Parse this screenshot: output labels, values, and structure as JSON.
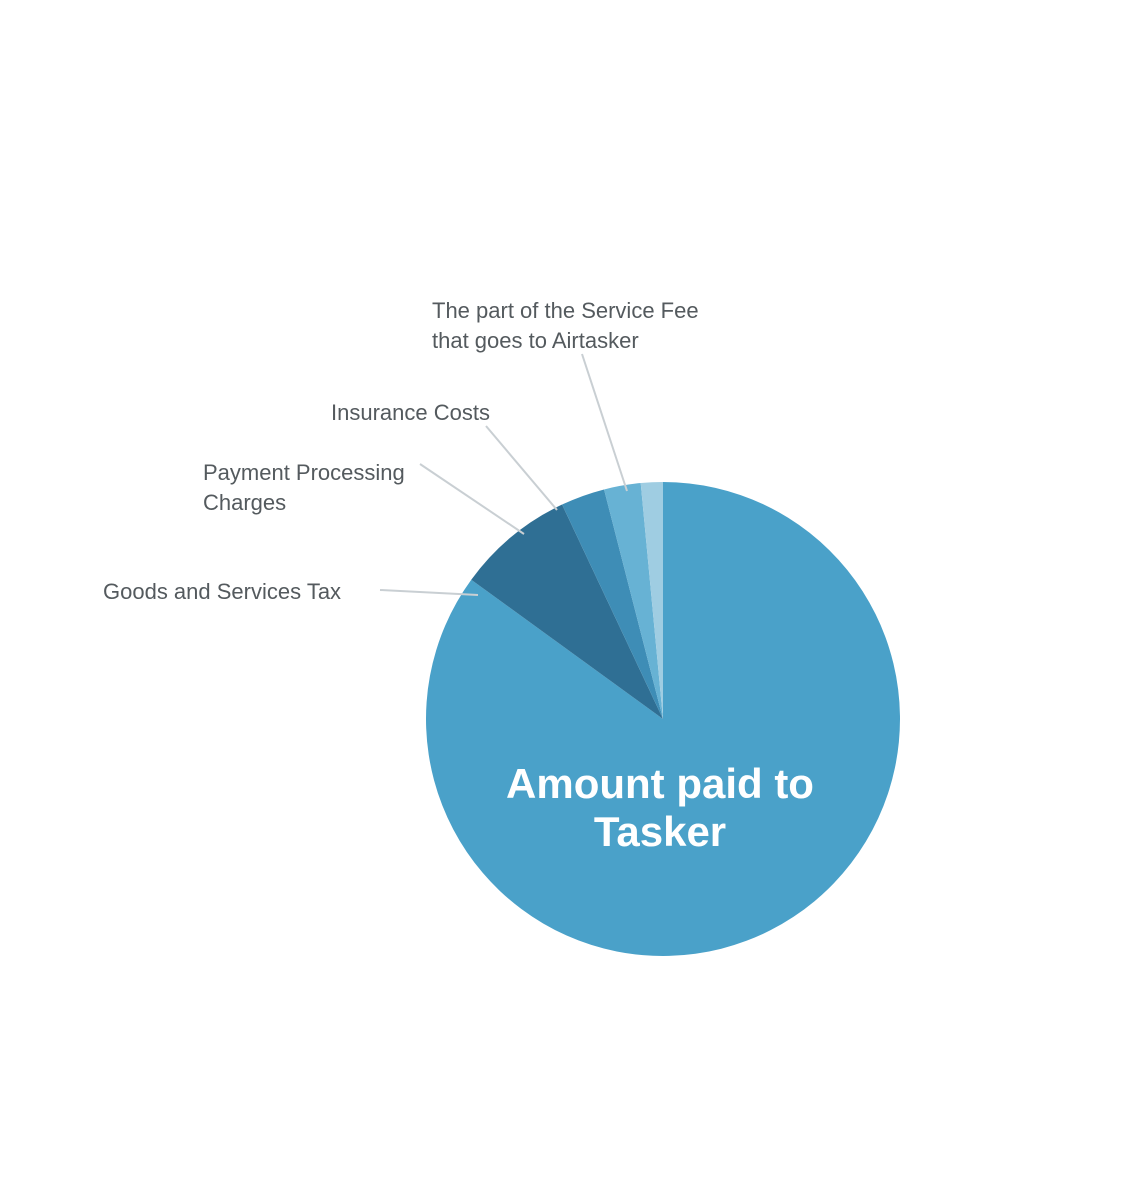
{
  "chart_data": {
    "type": "pie",
    "series": [
      {
        "name": "Amount paid to Tasker",
        "value": 85,
        "color": "#4aa1c9"
      },
      {
        "name": "The part of the Service Fee that goes to Airtasker",
        "value": 8,
        "color": "#2f6f94"
      },
      {
        "name": "Insurance Costs",
        "value": 3,
        "color": "#3e8db6"
      },
      {
        "name": "Payment Processing Charges",
        "value": 2.5,
        "color": "#67b2d4"
      },
      {
        "name": "Goods and Services Tax",
        "value": 1.5,
        "color": "#9fcde2"
      }
    ]
  },
  "labels": {
    "airtasker": "The part of the Service Fee that goes to Airtasker",
    "insurance": "Insurance Costs",
    "payment": "Payment Processing Charges",
    "gst": "Goods and Services Tax",
    "center": "Amount paid to Tasker"
  }
}
